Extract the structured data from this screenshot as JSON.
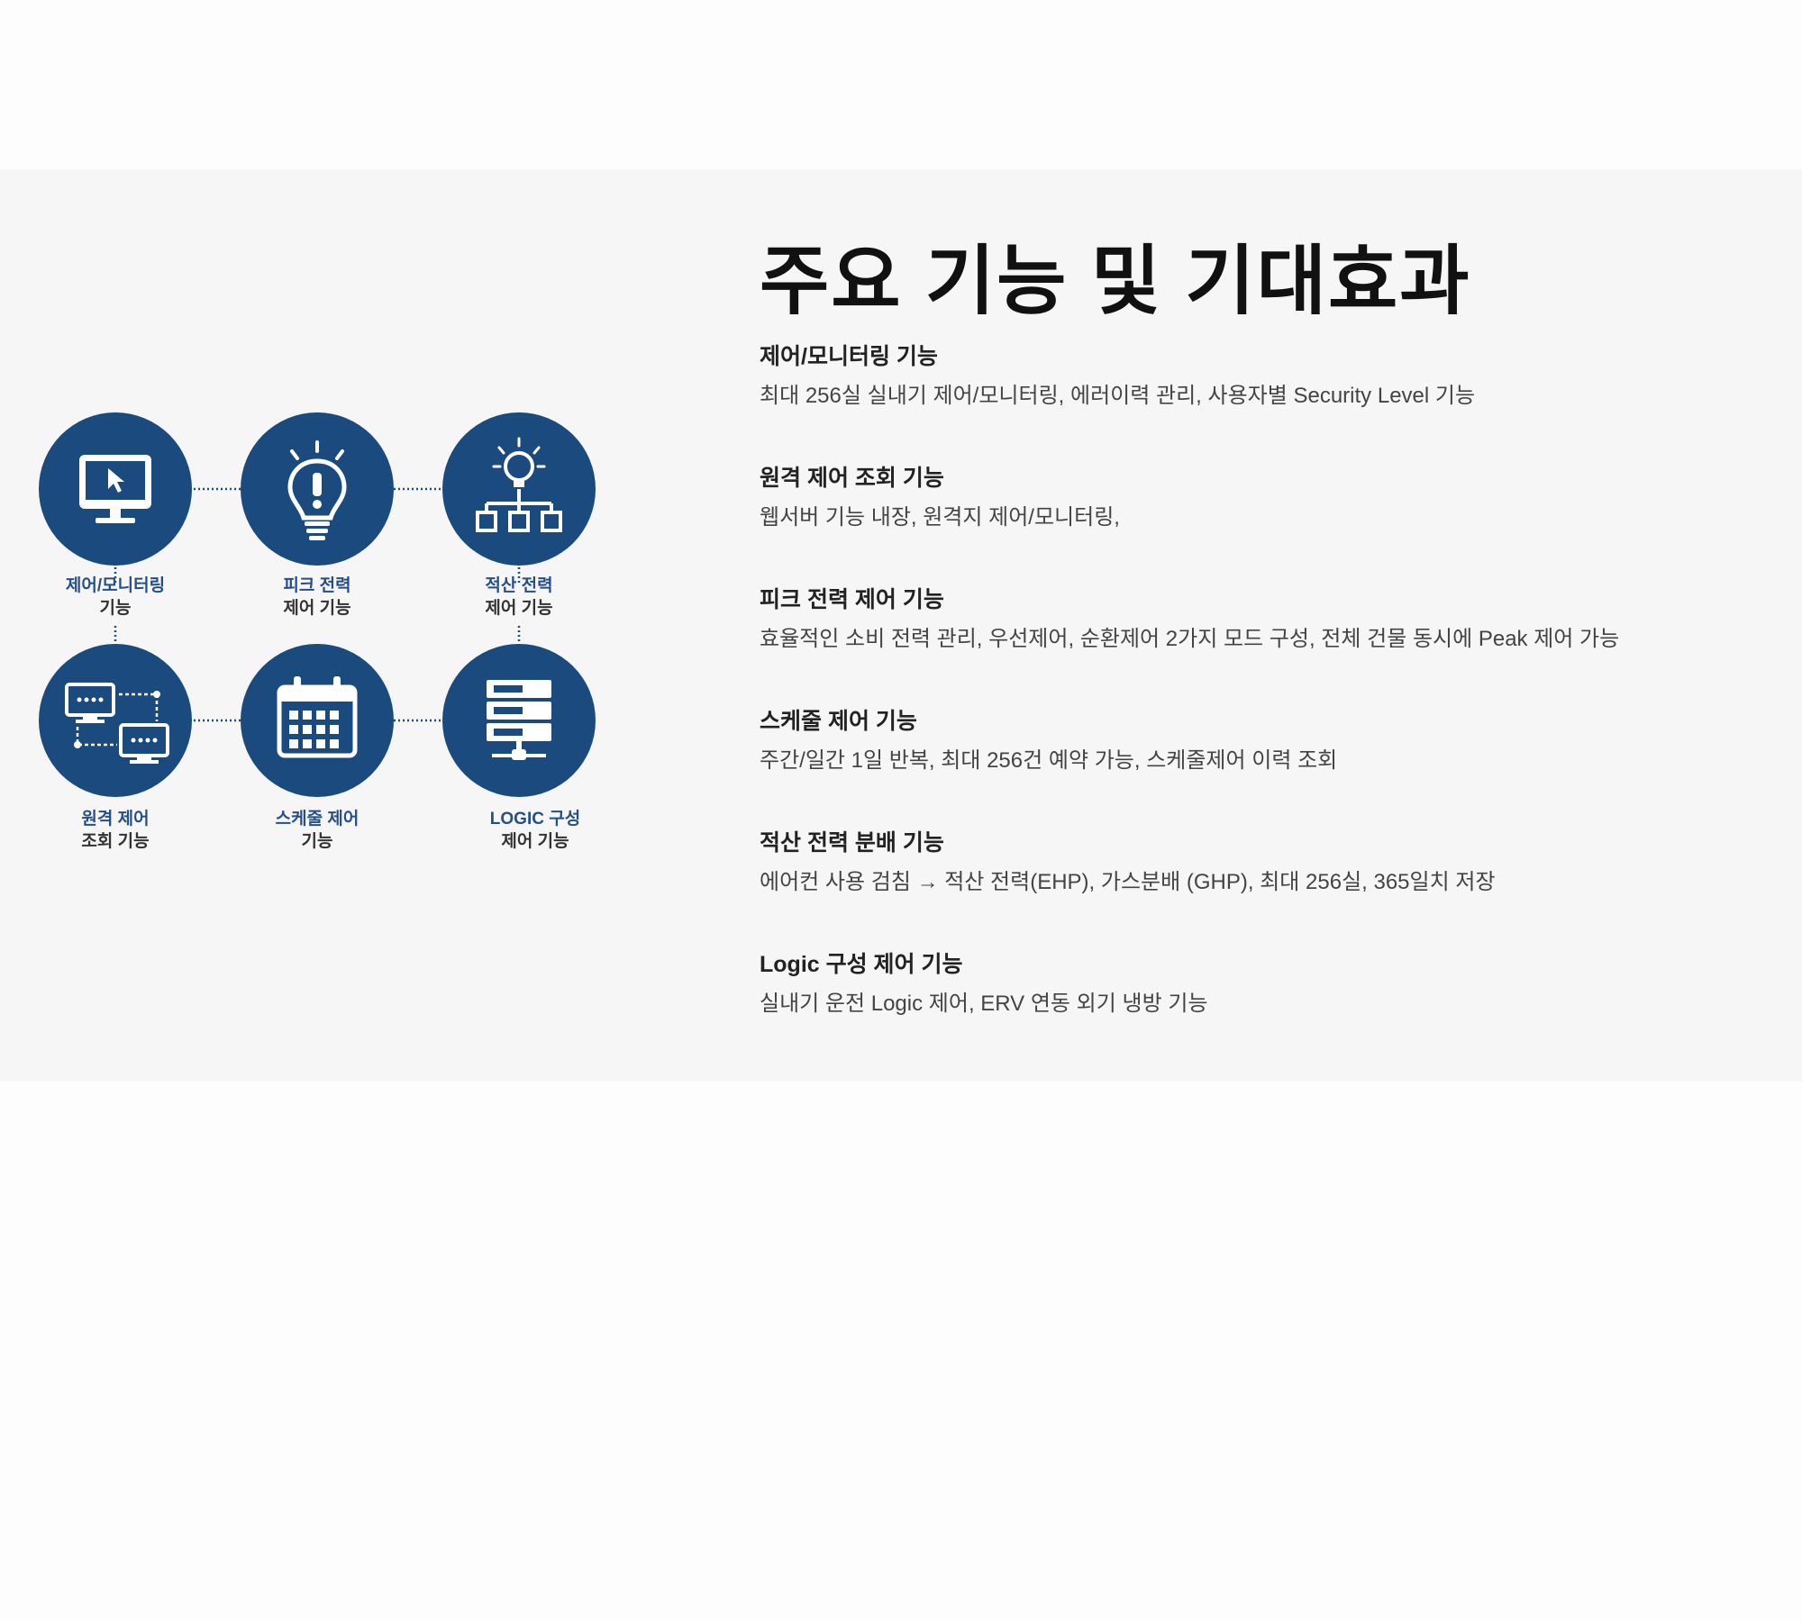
{
  "page": {
    "title": "주요 기능 및 기대효과",
    "colors": {
      "section_bg": "#f6f6f6",
      "circle": "#1a4a7e",
      "accent_label": "#264f86"
    }
  },
  "diagram": {
    "nodes": [
      {
        "icon": "monitor-cursor-icon",
        "line1": "제어/모니터링",
        "line2": "기능"
      },
      {
        "icon": "lightbulb-alert-icon",
        "line1": "피크 전력",
        "line2": "제어 기능"
      },
      {
        "icon": "lightbulb-hierarchy-icon",
        "line1": "적산 전력",
        "line2": "제어 기능"
      },
      {
        "icon": "remote-monitors-icon",
        "line1": "원격 제어",
        "line2": "조회 기능"
      },
      {
        "icon": "calendar-icon",
        "line1": "스케줄 제어",
        "line2": "기능"
      },
      {
        "icon": "server-stack-icon",
        "line1": "LOGIC 구성",
        "line2": "제어 기능"
      }
    ]
  },
  "features": [
    {
      "title": "제어/모니터링 기능",
      "desc": "최대 256실 실내기 제어/모니터링, 에러이력 관리, 사용자별 Security Level 기능"
    },
    {
      "title": "원격 제어 조회 기능",
      "desc": "웹서버 기능 내장, 원격지 제어/모니터링,"
    },
    {
      "title": "피크 전력 제어 기능",
      "desc": "효율적인 소비 전력 관리, 우선제어, 순환제어 2가지 모드 구성, 전체 건물 동시에 Peak 제어 가능"
    },
    {
      "title": "스케줄 제어 기능",
      "desc": "주간/일간 1일 반복, 최대 256건 예약 가능, 스케줄제어 이력 조회"
    },
    {
      "title": "적산 전력 분배 기능",
      "desc": "에어컨 사용 검침 → 적산 전력(EHP), 가스분배 (GHP), 최대 256실, 365일치 저장"
    },
    {
      "title": "Logic 구성 제어 기능",
      "desc": "실내기 운전 Logic 제어, ERV 연동 외기 냉방 기능"
    }
  ]
}
